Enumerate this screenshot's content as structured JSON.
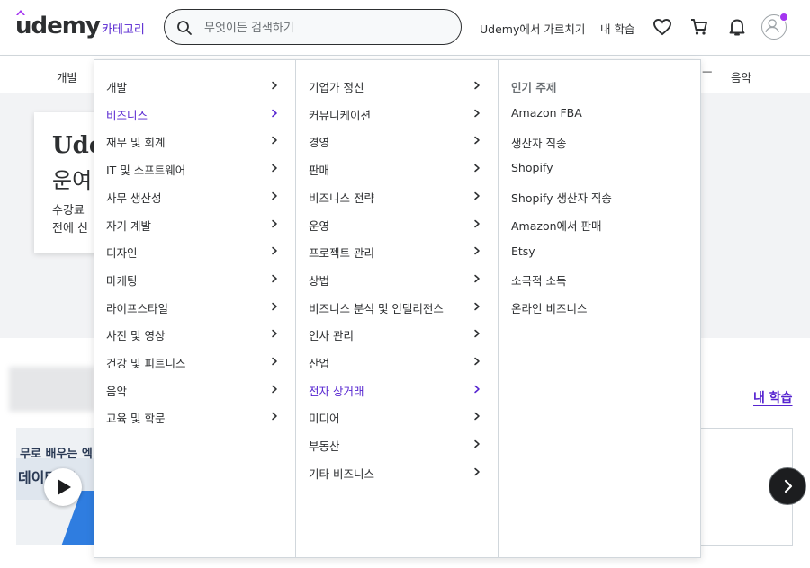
{
  "header": {
    "logo": "udemy",
    "categories_label": "카테고리",
    "search_placeholder": "무엇이든 검색하기",
    "teach_label": "Udemy에서 가르치기",
    "my_learning_label": "내 학습"
  },
  "subnav": {
    "left_item": "개발",
    "right_partial": "ㅡ",
    "right_item": "음악"
  },
  "hero": {
    "title_line1": "Ude",
    "title_line2": "운여",
    "text_line1": "수강료",
    "text_line2": "전에 신"
  },
  "section": {
    "my_learning_link": "내 학습",
    "thumb_line1": "무로 배우는 엑",
    "thumb_line2": "데이터 포"
  },
  "menu": {
    "col1": [
      "개발",
      "비즈니스",
      "재무 및 회계",
      "IT 및 소프트웨어",
      "사무 생산성",
      "자기 계발",
      "디자인",
      "마케팅",
      "라이프스타일",
      "사진 및 영상",
      "건강 및 피트니스",
      "음악",
      "교육 및 학문"
    ],
    "col1_active": 1,
    "col2": [
      "기업가 정신",
      "커뮤니케이션",
      "경영",
      "판매",
      "비즈니스 전략",
      "운영",
      "프로젝트 관리",
      "상법",
      "비즈니스 분석 및 인텔리전스",
      "인사 관리",
      "산업",
      "전자 상거래",
      "미디어",
      "부동산",
      "기타 비즈니스"
    ],
    "col2_active": 11,
    "col3_heading": "인기 주제",
    "col3": [
      "Amazon FBA",
      "생산자 직송",
      "Shopify",
      "Shopify 생산자 직송",
      "Amazon에서 판매",
      "Etsy",
      "소극적 소득",
      "온라인 비즈니스"
    ]
  },
  "colors": {
    "accent": "#5624d0",
    "text": "#2d2f31",
    "border": "#d1d7dc",
    "notification_dot": "#a435f0"
  }
}
